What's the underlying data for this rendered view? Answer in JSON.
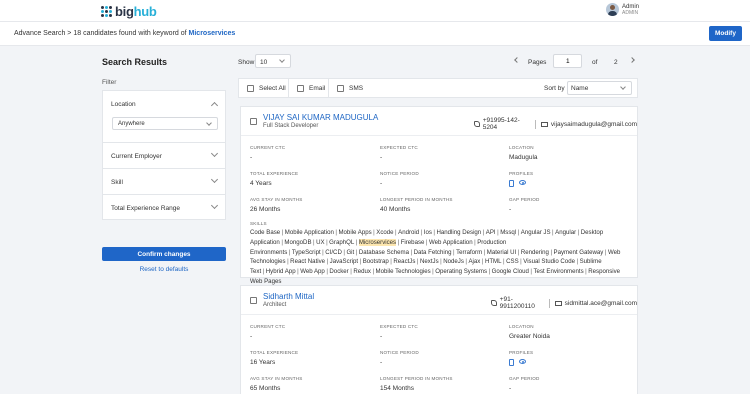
{
  "app": {
    "logo_prefix": "big",
    "logo_suffix": "hub"
  },
  "user": {
    "name": "Admin",
    "role": "ADMIN"
  },
  "breadcrumb": {
    "prefix": "Advance Search > 18 candidates found with keyword of ",
    "keyword": "Microservices"
  },
  "actions": {
    "modify": "Modify",
    "confirm": "Confirm changes",
    "reset": "Reset to defaults"
  },
  "sidebar": {
    "title": "Search Results",
    "filter_label": "Filter",
    "location_label": "Location",
    "location_value": "Anywhere",
    "sections": [
      "Current Employer",
      "Skill",
      "Total Experience Range"
    ]
  },
  "results_toolbar": {
    "show_label": "Show",
    "show_value": "10",
    "pages_label": "Pages",
    "page_current": "1",
    "of_label": "of",
    "page_total": "2",
    "select_all": "Select All",
    "email": "Email",
    "sms": "SMS",
    "sort_label": "Sort by",
    "sort_value": "Name"
  },
  "field_labels": {
    "current_ctc": "CURRENT CTC",
    "expected_ctc": "EXPECTED CTC",
    "location": "LOCATION",
    "total_experience": "TOTAL EXPERIENCE",
    "notice_period": "NOTICE PERIOD",
    "profiles": "PROFILES",
    "avg_stay": "AVG STAY IN MONTHS",
    "longest_period": "LONGEST PERIOD IN MONTHS",
    "gap_period": "GAP PERIOD",
    "skills": "SKILLS"
  },
  "candidates": [
    {
      "name": "VIJAY SAI KUMAR MADUGULA",
      "title": "Full Stack Developer",
      "phone": "+91995-142-5204",
      "email": "vijaysaimadugula@gmail.com",
      "current_ctc": "-",
      "expected_ctc": "-",
      "location": "Madugula",
      "total_experience": "4 Years",
      "notice_period": "-",
      "avg_stay": "26 Months",
      "longest_period": "40 Months",
      "gap_period": "-",
      "skills": [
        "Code Base",
        "Mobile Application",
        "Mobile Apps",
        "Xcode",
        "Android",
        "Ios",
        "Handling Design",
        "API",
        "Mssql",
        "Angular JS",
        "Angular",
        "Desktop Application",
        "MongoDB",
        "UX",
        "GraphQL",
        "Microservices",
        "Firebase",
        "Web Application",
        "Production Environments",
        "TypeScript",
        "CI/CD",
        "Git",
        "Database Schema",
        "Data Fetching",
        "Terraform",
        "Material UI",
        "Rendering",
        "Payment Gateway",
        "Web Technologies",
        "React Native",
        "JavaScript",
        "Bootstrap",
        "ReactJs",
        "NextJs",
        "NodeJs",
        "Ajax",
        "HTML",
        "CSS",
        "Visual Studio Code",
        "Sublime Text",
        "Hybrid App",
        "Web App",
        "Docker",
        "Redux",
        "Mobile Technologies",
        "Operating Systems",
        "Google Cloud",
        "Test Environments",
        "Responsive Web Pages"
      ],
      "highlight": "Microservices"
    },
    {
      "name": "Sidharth Mittal",
      "title": "Architect",
      "phone": "+91-9911200110",
      "email": "sidmittal.ace@gmail.com",
      "current_ctc": "-",
      "expected_ctc": "-",
      "location": "Greater Noida",
      "total_experience": "16 Years",
      "notice_period": "-",
      "avg_stay": "65 Months",
      "longest_period": "154 Months",
      "gap_period": "-"
    }
  ],
  "colors": {
    "primary": "#1f66c8",
    "link": "#1e66c4",
    "highlight": "#fde7b0",
    "logo_dots": [
      "#2a3446",
      "#28b0d8",
      "#2a3446",
      "#28b0d8",
      "#2a3446",
      "#28b0d8",
      "#2a3446",
      "#28b0d8",
      "#2a3446"
    ]
  }
}
